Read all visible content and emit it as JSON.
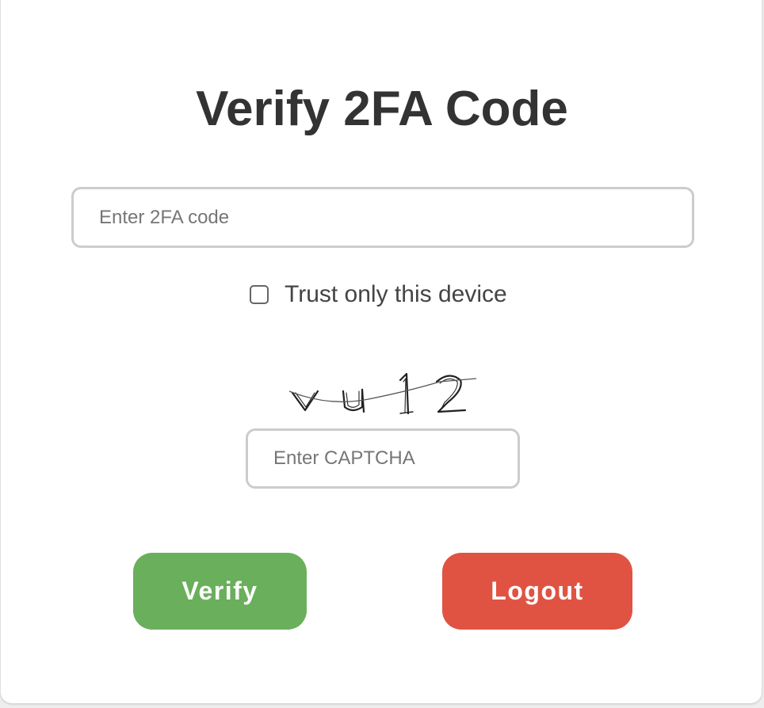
{
  "page": {
    "title": "Verify 2FA Code"
  },
  "form": {
    "code_placeholder": "Enter 2FA code",
    "code_value": "",
    "trust_label": "Trust only this device",
    "trust_checked": false,
    "captcha_text": "vu12",
    "captcha_placeholder": "Enter CAPTCHA",
    "captcha_value": ""
  },
  "actions": {
    "verify_label": "Verify",
    "logout_label": "Logout"
  },
  "colors": {
    "verify": "#6aaf5b",
    "logout": "#e05342",
    "title": "#333333"
  }
}
